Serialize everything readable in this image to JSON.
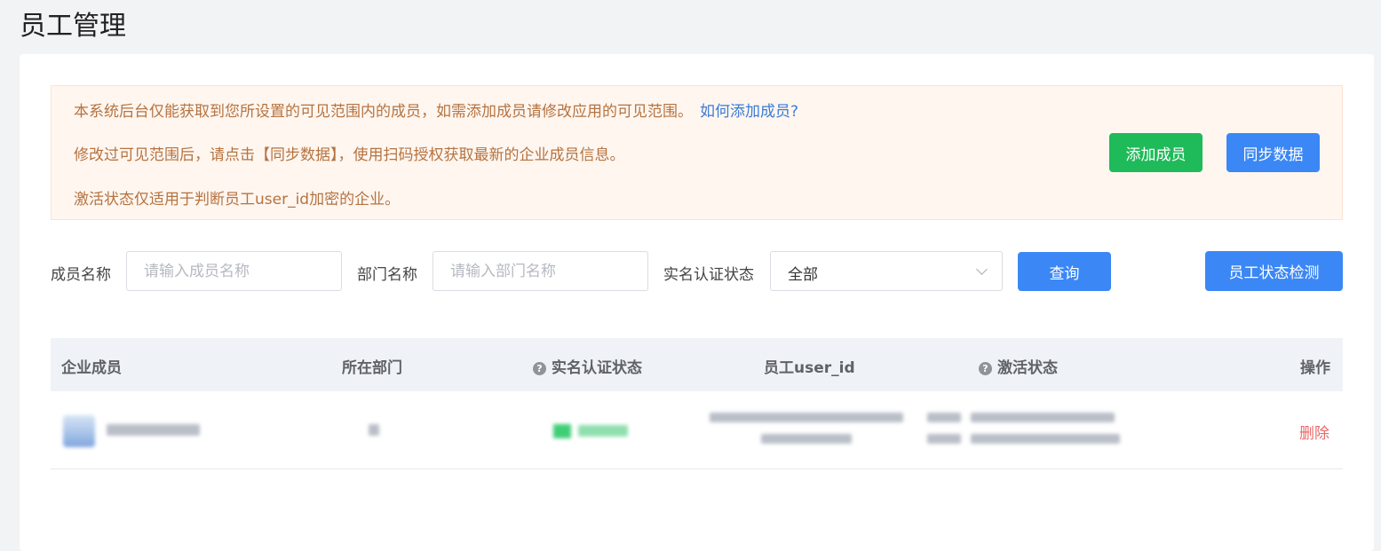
{
  "page": {
    "title": "员工管理"
  },
  "notice": {
    "line1": "本系统后台仅能获取到您所设置的可见范围内的成员，如需添加成员请修改应用的可见范围。",
    "link": "如何添加成员?",
    "line2": "修改过可见范围后，请点击【同步数据】，使用扫码授权获取最新的企业成员信息。",
    "line3": "激活状态仅适用于判断员工user_id加密的企业。",
    "add_button": "添加成员",
    "sync_button": "同步数据"
  },
  "filters": {
    "member_label": "成员名称",
    "member_placeholder": "请输入成员名称",
    "dept_label": "部门名称",
    "dept_placeholder": "请输入部门名称",
    "status_label": "实名认证状态",
    "status_value": "全部",
    "query_button": "查询",
    "check_button": "员工状态检测"
  },
  "table": {
    "headers": {
      "member": "企业成员",
      "dept": "所在部门",
      "auth_status": "实名认证状态",
      "user_id": "员工user_id",
      "active_status": "激活状态",
      "actions": "操作"
    },
    "rows": [
      {
        "delete_label": "删除"
      }
    ]
  },
  "colors": {
    "primary": "#3b87f5",
    "success": "#1fba59",
    "danger": "#e86a6a",
    "notice_text": "#b5733f",
    "link": "#3b7bd4"
  }
}
